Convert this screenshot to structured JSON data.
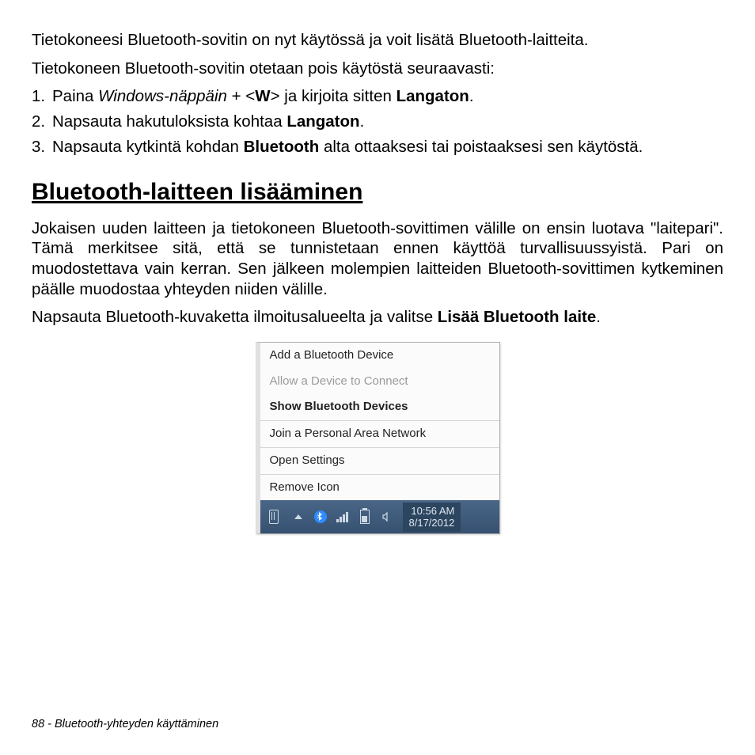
{
  "intro1": "Tietokoneesi Bluetooth-sovitin on nyt käytössä ja voit lisätä Bluetooth-laitteita.",
  "intro2": "Tietokoneen Bluetooth-sovitin otetaan pois käytöstä seuraavasti:",
  "steps": {
    "s1num": "1.",
    "s1a": "Paina ",
    "s1b": "Windows-näppäin",
    "s1c": " + <",
    "s1d": "W",
    "s1e": "> ja kirjoita sitten ",
    "s1f": "Langaton",
    "s1g": ".",
    "s2num": "2.",
    "s2a": "Napsauta hakutuloksista kohtaa ",
    "s2b": "Langaton",
    "s2c": ".",
    "s3num": "3.",
    "s3a": "Napsauta kytkintä kohdan ",
    "s3b": "Bluetooth",
    "s3c": " alta ottaaksesi tai poistaaksesi sen käytöstä."
  },
  "heading": "Bluetooth-laitteen lisääminen",
  "body1": "Jokaisen uuden laitteen ja tietokoneen Bluetooth-sovittimen välille on ensin luotava \"laitepari\". Tämä merkitsee sitä, että se tunnistetaan ennen käyttöä turvallisuussyistä. Pari on muodostettava vain kerran. Sen jälkeen molempien laitteiden Bluetooth-sovittimen kytkeminen päälle muodostaa yhteyden niiden välille.",
  "body2a": "Napsauta Bluetooth-kuvaketta ilmoitusalueelta ja valitse ",
  "body2b": "Lisää Bluetooth laite",
  "body2c": ".",
  "menu": {
    "add": "Add a Bluetooth Device",
    "allow": "Allow a Device to Connect",
    "show": "Show Bluetooth Devices",
    "join": "Join a Personal Area Network",
    "open": "Open Settings",
    "remove": "Remove Icon"
  },
  "taskbar": {
    "time": "10:56 AM",
    "date": "8/17/2012"
  },
  "footer": {
    "page": "88 - ",
    "title": "Bluetooth-yhteyden käyttäminen"
  }
}
